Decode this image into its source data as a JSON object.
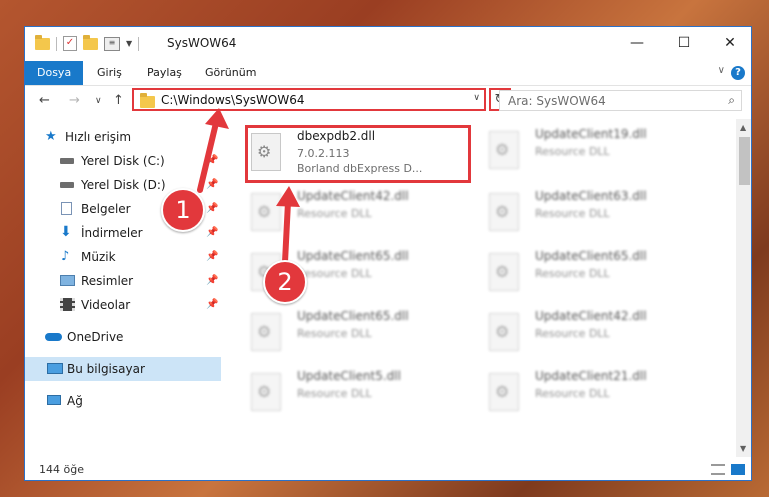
{
  "window": {
    "title": "SysWOW64",
    "minimize_glyph": "—",
    "maximize_glyph": "☐",
    "close_glyph": "✕"
  },
  "ribbon": {
    "tabs": [
      {
        "label": "Dosya",
        "active": true
      },
      {
        "label": "Giriş"
      },
      {
        "label": "Paylaş"
      },
      {
        "label": "Görünüm"
      }
    ],
    "collapse_glyph": "∨",
    "help_glyph": "?"
  },
  "navigation": {
    "back_glyph": "←",
    "forward_glyph": "→",
    "recent_glyph": "∨",
    "up_glyph": "↑",
    "address": "C:\\Windows\\SysWOW64",
    "address_dropdown_glyph": "∨",
    "refresh_glyph": "↻",
    "search_placeholder": "Ara: SysWOW64",
    "search_glyph": "⌕"
  },
  "sidebar": {
    "items": [
      {
        "label": "Hızlı erişim",
        "icon": "star-icon",
        "pinned": false
      },
      {
        "label": "Yerel Disk (C:)",
        "icon": "drive-icon",
        "pinned": true
      },
      {
        "label": "Yerel Disk (D:)",
        "icon": "drive-icon",
        "pinned": true
      },
      {
        "label": "Belgeler",
        "icon": "document-icon",
        "pinned": true
      },
      {
        "label": "İndirmeler",
        "icon": "download-icon",
        "pinned": true
      },
      {
        "label": "Müzik",
        "icon": "music-icon",
        "pinned": true
      },
      {
        "label": "Resimler",
        "icon": "picture-icon",
        "pinned": true
      },
      {
        "label": "Videolar",
        "icon": "video-icon",
        "pinned": true
      },
      {
        "label": "OneDrive",
        "icon": "cloud-icon",
        "pinned": false
      },
      {
        "label": "Bu bilgisayar",
        "icon": "computer-icon",
        "pinned": false,
        "selected": true
      },
      {
        "label": "Ağ",
        "icon": "network-icon",
        "pinned": false
      }
    ],
    "pin_glyph": "📌"
  },
  "files": [
    {
      "name": "dbexpdb2.dll",
      "line1": "7.0.2.113",
      "line2": "Borland dbExpress D...",
      "highlighted": true
    },
    {
      "name": "UpdateClient19.dll",
      "line1": "Resource DLL"
    },
    {
      "name": "UpdateClient42.dll",
      "line1": "Resource DLL"
    },
    {
      "name": "UpdateClient63.dll",
      "line1": "Resource DLL"
    },
    {
      "name": "UpdateClient65.dll",
      "line1": "Resource DLL"
    },
    {
      "name": "UpdateClient65.dll",
      "line1": "Resource DLL"
    },
    {
      "name": "UpdateClient65.dll",
      "line1": "Resource DLL"
    },
    {
      "name": "UpdateClient42.dll",
      "line1": "Resource DLL"
    },
    {
      "name": "UpdateClient5.dll",
      "line1": "Resource DLL"
    },
    {
      "name": "UpdateClient21.dll",
      "line1": "Resource DLL"
    }
  ],
  "status": {
    "item_count": "144 öğe"
  },
  "annotations": {
    "badge_1": "1",
    "badge_2": "2",
    "color": "#e2383c"
  },
  "colors": {
    "accent": "#1979ca",
    "selection": "#cce4f7",
    "highlight": "#e2383c"
  }
}
